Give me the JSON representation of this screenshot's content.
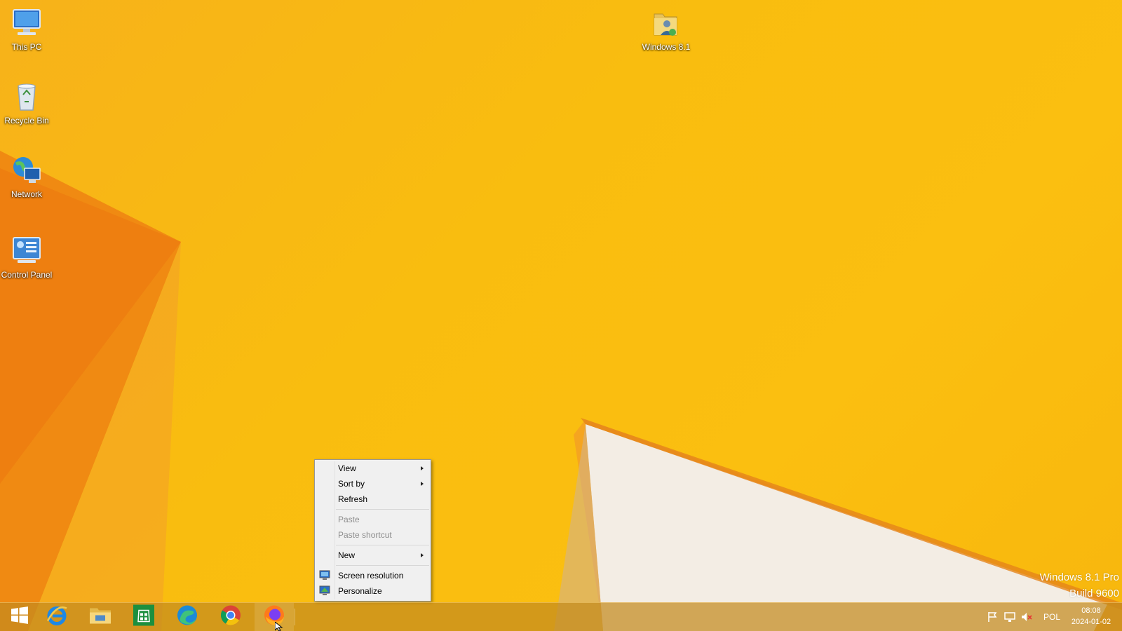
{
  "desktop": {
    "icons": [
      {
        "label": "This PC"
      },
      {
        "label": "Recycle Bin"
      },
      {
        "label": "Network"
      },
      {
        "label": "Control Panel"
      },
      {
        "label": "Windows 8.1"
      }
    ],
    "watermark": {
      "line1": "Windows 8.1 Pro",
      "line2": "Build 9600"
    }
  },
  "context_menu": {
    "items": [
      {
        "label": "View",
        "submenu": true
      },
      {
        "label": "Sort by",
        "submenu": true
      },
      {
        "label": "Refresh"
      },
      {
        "label": "Paste",
        "disabled": true
      },
      {
        "label": "Paste shortcut",
        "disabled": true
      },
      {
        "label": "New",
        "submenu": true
      },
      {
        "label": "Screen resolution",
        "icon": "screen-resolution-icon"
      },
      {
        "label": "Personalize",
        "icon": "personalize-icon"
      }
    ]
  },
  "taskbar": {
    "pinned": [
      {
        "name": "start-button",
        "icon": "windows-logo-icon"
      },
      {
        "name": "internet-explorer",
        "icon": "internet-explorer-icon"
      },
      {
        "name": "file-explorer",
        "icon": "folder-icon"
      },
      {
        "name": "store",
        "icon": "store-icon"
      },
      {
        "name": "edge",
        "icon": "edge-icon"
      },
      {
        "name": "chrome",
        "icon": "chrome-icon"
      },
      {
        "name": "firefox",
        "icon": "firefox-icon"
      }
    ],
    "tray": {
      "language": "POL",
      "time": "08:08",
      "date": "2024-01-02"
    }
  },
  "colors": {
    "wallpaper": "#f9bd0f",
    "taskbar": "#c48a1e",
    "menu_bg": "#f0f0f0"
  }
}
